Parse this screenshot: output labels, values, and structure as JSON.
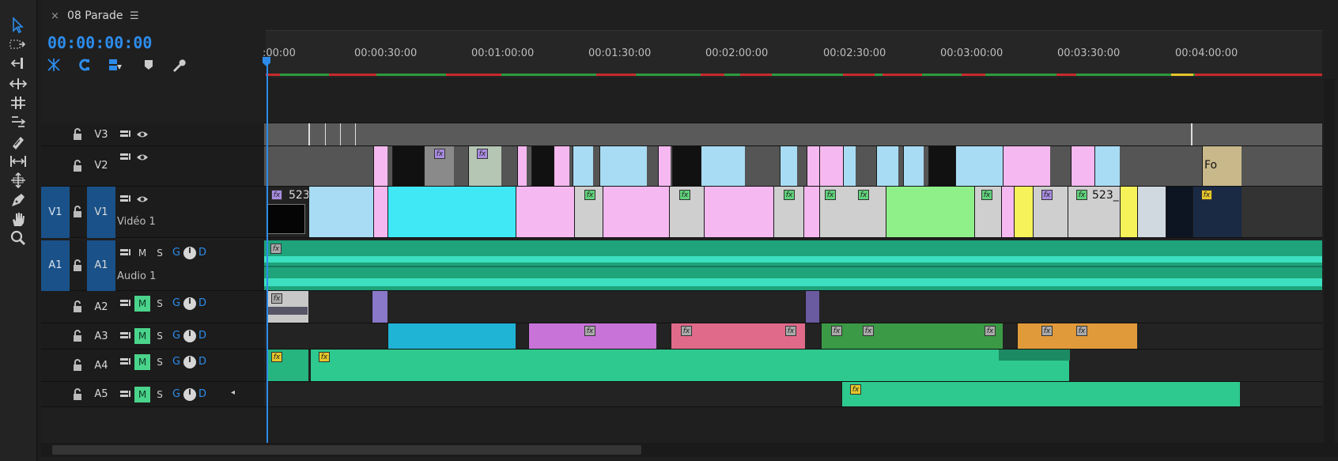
{
  "sequence": {
    "title": "08 Parade",
    "close_icon": "close-icon",
    "menu_icon": "hamburger-menu-icon"
  },
  "timecode": "00:00:00:00",
  "ruler": {
    "labels": [
      ":00:00",
      "00:00:30:00",
      "00:01:00:00",
      "00:01:30:00",
      "00:02:00:00",
      "00:02:30:00",
      "00:03:00:00",
      "00:03:30:00",
      "00:04:00:00"
    ]
  },
  "tools": [
    "selection-tool-icon",
    "track-select-icon",
    "ripple-edit-icon",
    "rolling-edit-icon",
    "rate-stretch-icon",
    "slip-icon",
    "razor-icon",
    "slide-icon",
    "pen-icon",
    "hand-icon",
    "zoom-icon"
  ],
  "controls": [
    "nest-icon",
    "snap-icon",
    "linked-selection-icon",
    "marker-icon",
    "wrench-icon"
  ],
  "tracks": {
    "v3": {
      "name": "V3"
    },
    "v2": {
      "name": "V2"
    },
    "v1": {
      "src": "V1",
      "name": "V1",
      "label": "Vidéo 1"
    },
    "a1": {
      "src": "A1",
      "name": "A1",
      "label": "Audio 1"
    },
    "a2": {
      "name": "A2"
    },
    "a3": {
      "name": "A3"
    },
    "a4": {
      "name": "A4"
    },
    "a5": {
      "name": "A5"
    }
  },
  "buttons": {
    "mute": "M",
    "solo": "S",
    "gain": "G",
    "d": "D",
    "fx": "fx"
  },
  "clip_names": {
    "v1_first": "523",
    "v1_later": "523_",
    "v2_end": "Fo"
  },
  "colors": {
    "accent": "#2d8ceb",
    "track_blue": "#1a5189",
    "mute_on": "#4ad38b",
    "audio_teal": "#3ce0c0"
  }
}
